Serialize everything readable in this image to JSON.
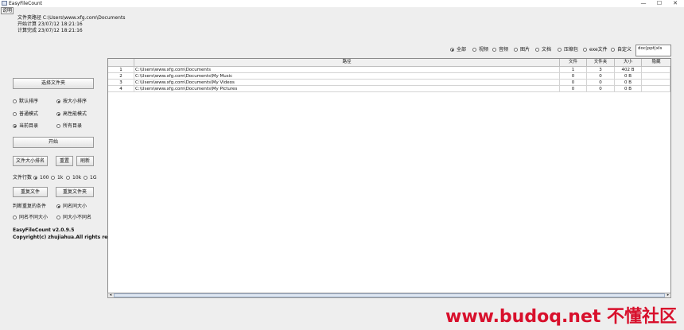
{
  "window": {
    "title": "EasyFileCount",
    "minimize": "—",
    "maximize": "☐",
    "close": "✕"
  },
  "menu": {
    "help": "说明"
  },
  "info": {
    "folder_path": "文件夹路径 C:\\Users\\www.xfg.com\\Documents",
    "start_time": "开始计算 23/07/12 18:21:16",
    "end_time": "计算完成 23/07/12 18:21:16"
  },
  "left": {
    "select_folder": "选择文件夹",
    "sort_default": "默认排序",
    "sort_size": "按大小排序",
    "mode_normal": "普通模式",
    "mode_high": "高性能模式",
    "dir_current": "当前目录",
    "dir_all": "所有目录",
    "start": "开始",
    "rank_size": "文件大小排名",
    "reset": "重置",
    "refresh": "刷新",
    "rows_label": "文件行数",
    "rows_opts": [
      "100",
      "1k",
      "10k",
      "1G"
    ],
    "dup_file": "重复文件",
    "dup_folder": "重复文件夹",
    "dup_cond_label": "判断重复的条件",
    "cond_same_name_size": "同名同大小",
    "cond_diff_name_size": "同名不同大小",
    "cond_same_size_diff_name": "同大小不同名",
    "version": "EasyFileCount v2.0.9.5",
    "copyright": "Copyright(c) zhujiahua.All rights reserved."
  },
  "filters": {
    "options": [
      "全部",
      "视频",
      "音频",
      "图片",
      "文档",
      "压缩包",
      "exe文件",
      "自定义"
    ],
    "selected": "全部",
    "custom_value": "doc|ppt|xls"
  },
  "table": {
    "columns": [
      "",
      "路径",
      "文件",
      "文件夹",
      "大小",
      "隐藏"
    ],
    "rows": [
      [
        "1",
        "C:\\Users\\www.xfg.com\\Documents",
        "1",
        "3",
        "402 B",
        ""
      ],
      [
        "2",
        "C:\\Users\\www.xfg.com\\Documents\\My Music",
        "0",
        "0",
        "0 B",
        ""
      ],
      [
        "3",
        "C:\\Users\\www.xfg.com\\Documents\\My Videos",
        "0",
        "0",
        "0 B",
        ""
      ],
      [
        "4",
        "C:\\Users\\www.xfg.com\\Documents\\My Pictures",
        "0",
        "0",
        "0 B",
        ""
      ]
    ]
  },
  "watermark": "www.budoq.net 不懂社区"
}
